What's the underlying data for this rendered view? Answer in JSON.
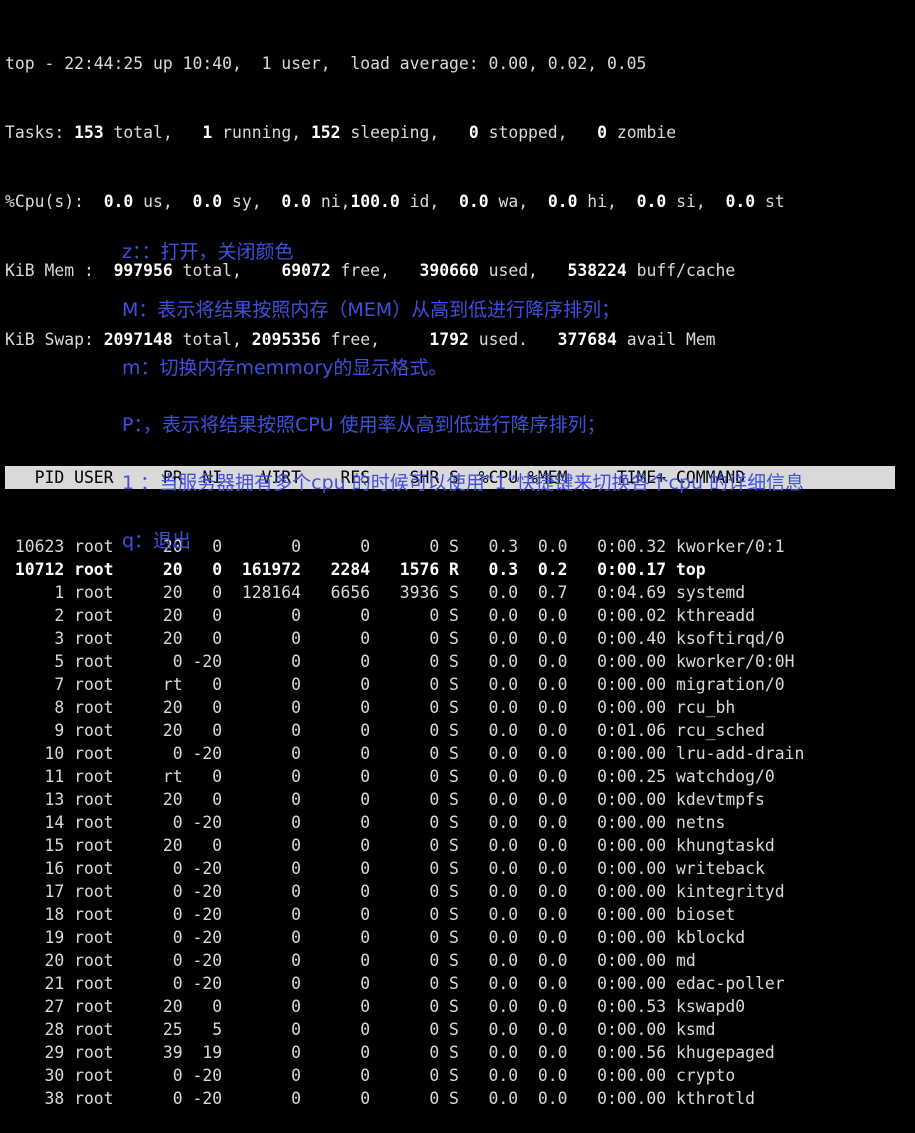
{
  "summary": {
    "uptime_line": [
      "top - 22:44:25 up 10:40,  1 user,  load average: 0.00, 0.02, 0.05"
    ],
    "tasks": [
      [
        "Tasks: ",
        false
      ],
      [
        "153",
        true
      ],
      [
        " total,   ",
        false
      ],
      [
        "1",
        true
      ],
      [
        " running, ",
        false
      ],
      [
        "152",
        true
      ],
      [
        " sleeping,   ",
        false
      ],
      [
        "0",
        true
      ],
      [
        " stopped,   ",
        false
      ],
      [
        "0",
        true
      ],
      [
        " zombie",
        false
      ]
    ],
    "cpu": [
      [
        "%Cpu(s):  ",
        false
      ],
      [
        "0.0",
        true
      ],
      [
        " us,  ",
        false
      ],
      [
        "0.0",
        true
      ],
      [
        " sy,  ",
        false
      ],
      [
        "0.0",
        true
      ],
      [
        " ni,",
        false
      ],
      [
        "100.0",
        true
      ],
      [
        " id,  ",
        false
      ],
      [
        "0.0",
        true
      ],
      [
        " wa,  ",
        false
      ],
      [
        "0.0",
        true
      ],
      [
        " hi,  ",
        false
      ],
      [
        "0.0",
        true
      ],
      [
        " si,  ",
        false
      ],
      [
        "0.0",
        true
      ],
      [
        " st",
        false
      ]
    ],
    "mem": [
      [
        "KiB Mem :  ",
        false
      ],
      [
        "997956",
        true
      ],
      [
        " total,    ",
        false
      ],
      [
        "69072",
        true
      ],
      [
        " free,   ",
        false
      ],
      [
        "390660",
        true
      ],
      [
        " used,   ",
        false
      ],
      [
        "538224",
        true
      ],
      [
        " buff/cache",
        false
      ]
    ],
    "swap": [
      [
        "KiB Swap: ",
        false
      ],
      [
        "2097148",
        true
      ],
      [
        " total, ",
        false
      ],
      [
        "2095356",
        true
      ],
      [
        " free,     ",
        false
      ],
      [
        "1792",
        true
      ],
      [
        " used.   ",
        false
      ],
      [
        "377684",
        true
      ],
      [
        " avail Mem",
        false
      ]
    ]
  },
  "columns": [
    "PID",
    "USER",
    "PR",
    "NI",
    "VIRT",
    "RES",
    "SHR",
    "S",
    "%CPU",
    "%MEM",
    "TIME+",
    "COMMAND"
  ],
  "processes": [
    {
      "pid": "10623",
      "user": "root",
      "pr": "20",
      "ni": "0",
      "virt": "0",
      "res": "0",
      "shr": "0",
      "s": "S",
      "cpu": "0.3",
      "mem": "0.0",
      "time": "0:00.32",
      "cmd": "kworker/0:1",
      "bold": false
    },
    {
      "pid": "10712",
      "user": "root",
      "pr": "20",
      "ni": "0",
      "virt": "161972",
      "res": "2284",
      "shr": "1576",
      "s": "R",
      "cpu": "0.3",
      "mem": "0.2",
      "time": "0:00.17",
      "cmd": "top",
      "bold": true
    },
    {
      "pid": "1",
      "user": "root",
      "pr": "20",
      "ni": "0",
      "virt": "128164",
      "res": "6656",
      "shr": "3936",
      "s": "S",
      "cpu": "0.0",
      "mem": "0.7",
      "time": "0:04.69",
      "cmd": "systemd",
      "bold": false
    },
    {
      "pid": "2",
      "user": "root",
      "pr": "20",
      "ni": "0",
      "virt": "0",
      "res": "0",
      "shr": "0",
      "s": "S",
      "cpu": "0.0",
      "mem": "0.0",
      "time": "0:00.02",
      "cmd": "kthreadd",
      "bold": false
    },
    {
      "pid": "3",
      "user": "root",
      "pr": "20",
      "ni": "0",
      "virt": "0",
      "res": "0",
      "shr": "0",
      "s": "S",
      "cpu": "0.0",
      "mem": "0.0",
      "time": "0:00.40",
      "cmd": "ksoftirqd/0",
      "bold": false
    },
    {
      "pid": "5",
      "user": "root",
      "pr": "0",
      "ni": "-20",
      "virt": "0",
      "res": "0",
      "shr": "0",
      "s": "S",
      "cpu": "0.0",
      "mem": "0.0",
      "time": "0:00.00",
      "cmd": "kworker/0:0H",
      "bold": false
    },
    {
      "pid": "7",
      "user": "root",
      "pr": "rt",
      "ni": "0",
      "virt": "0",
      "res": "0",
      "shr": "0",
      "s": "S",
      "cpu": "0.0",
      "mem": "0.0",
      "time": "0:00.00",
      "cmd": "migration/0",
      "bold": false
    },
    {
      "pid": "8",
      "user": "root",
      "pr": "20",
      "ni": "0",
      "virt": "0",
      "res": "0",
      "shr": "0",
      "s": "S",
      "cpu": "0.0",
      "mem": "0.0",
      "time": "0:00.00",
      "cmd": "rcu_bh",
      "bold": false
    },
    {
      "pid": "9",
      "user": "root",
      "pr": "20",
      "ni": "0",
      "virt": "0",
      "res": "0",
      "shr": "0",
      "s": "S",
      "cpu": "0.0",
      "mem": "0.0",
      "time": "0:01.06",
      "cmd": "rcu_sched",
      "bold": false
    },
    {
      "pid": "10",
      "user": "root",
      "pr": "0",
      "ni": "-20",
      "virt": "0",
      "res": "0",
      "shr": "0",
      "s": "S",
      "cpu": "0.0",
      "mem": "0.0",
      "time": "0:00.00",
      "cmd": "lru-add-drain",
      "bold": false
    },
    {
      "pid": "11",
      "user": "root",
      "pr": "rt",
      "ni": "0",
      "virt": "0",
      "res": "0",
      "shr": "0",
      "s": "S",
      "cpu": "0.0",
      "mem": "0.0",
      "time": "0:00.25",
      "cmd": "watchdog/0",
      "bold": false
    },
    {
      "pid": "13",
      "user": "root",
      "pr": "20",
      "ni": "0",
      "virt": "0",
      "res": "0",
      "shr": "0",
      "s": "S",
      "cpu": "0.0",
      "mem": "0.0",
      "time": "0:00.00",
      "cmd": "kdevtmpfs",
      "bold": false
    },
    {
      "pid": "14",
      "user": "root",
      "pr": "0",
      "ni": "-20",
      "virt": "0",
      "res": "0",
      "shr": "0",
      "s": "S",
      "cpu": "0.0",
      "mem": "0.0",
      "time": "0:00.00",
      "cmd": "netns",
      "bold": false
    },
    {
      "pid": "15",
      "user": "root",
      "pr": "20",
      "ni": "0",
      "virt": "0",
      "res": "0",
      "shr": "0",
      "s": "S",
      "cpu": "0.0",
      "mem": "0.0",
      "time": "0:00.00",
      "cmd": "khungtaskd",
      "bold": false
    },
    {
      "pid": "16",
      "user": "root",
      "pr": "0",
      "ni": "-20",
      "virt": "0",
      "res": "0",
      "shr": "0",
      "s": "S",
      "cpu": "0.0",
      "mem": "0.0",
      "time": "0:00.00",
      "cmd": "writeback",
      "bold": false
    },
    {
      "pid": "17",
      "user": "root",
      "pr": "0",
      "ni": "-20",
      "virt": "0",
      "res": "0",
      "shr": "0",
      "s": "S",
      "cpu": "0.0",
      "mem": "0.0",
      "time": "0:00.00",
      "cmd": "kintegrityd",
      "bold": false
    },
    {
      "pid": "18",
      "user": "root",
      "pr": "0",
      "ni": "-20",
      "virt": "0",
      "res": "0",
      "shr": "0",
      "s": "S",
      "cpu": "0.0",
      "mem": "0.0",
      "time": "0:00.00",
      "cmd": "bioset",
      "bold": false
    },
    {
      "pid": "19",
      "user": "root",
      "pr": "0",
      "ni": "-20",
      "virt": "0",
      "res": "0",
      "shr": "0",
      "s": "S",
      "cpu": "0.0",
      "mem": "0.0",
      "time": "0:00.00",
      "cmd": "kblockd",
      "bold": false
    },
    {
      "pid": "20",
      "user": "root",
      "pr": "0",
      "ni": "-20",
      "virt": "0",
      "res": "0",
      "shr": "0",
      "s": "S",
      "cpu": "0.0",
      "mem": "0.0",
      "time": "0:00.00",
      "cmd": "md",
      "bold": false
    },
    {
      "pid": "21",
      "user": "root",
      "pr": "0",
      "ni": "-20",
      "virt": "0",
      "res": "0",
      "shr": "0",
      "s": "S",
      "cpu": "0.0",
      "mem": "0.0",
      "time": "0:00.00",
      "cmd": "edac-poller",
      "bold": false
    },
    {
      "pid": "27",
      "user": "root",
      "pr": "20",
      "ni": "0",
      "virt": "0",
      "res": "0",
      "shr": "0",
      "s": "S",
      "cpu": "0.0",
      "mem": "0.0",
      "time": "0:00.53",
      "cmd": "kswapd0",
      "bold": false
    },
    {
      "pid": "28",
      "user": "root",
      "pr": "25",
      "ni": "5",
      "virt": "0",
      "res": "0",
      "shr": "0",
      "s": "S",
      "cpu": "0.0",
      "mem": "0.0",
      "time": "0:00.00",
      "cmd": "ksmd",
      "bold": false
    },
    {
      "pid": "29",
      "user": "root",
      "pr": "39",
      "ni": "19",
      "virt": "0",
      "res": "0",
      "shr": "0",
      "s": "S",
      "cpu": "0.0",
      "mem": "0.0",
      "time": "0:00.56",
      "cmd": "khugepaged",
      "bold": false
    },
    {
      "pid": "30",
      "user": "root",
      "pr": "0",
      "ni": "-20",
      "virt": "0",
      "res": "0",
      "shr": "0",
      "s": "S",
      "cpu": "0.0",
      "mem": "0.0",
      "time": "0:00.00",
      "cmd": "crypto",
      "bold": false
    },
    {
      "pid": "38",
      "user": "root",
      "pr": "0",
      "ni": "-20",
      "virt": "0",
      "res": "0",
      "shr": "0",
      "s": "S",
      "cpu": "0.0",
      "mem": "0.0",
      "time": "0:00.00",
      "cmd": "kthrotld",
      "bold": false
    }
  ],
  "annotations": [
    "z：：打开，关闭颜色",
    "M：表示将结果按照内存（MEM）从高到低进行降序排列；",
    "m：切换内存memmory的显示格式。",
    "P：，表示将结果按照CPU 使用率从高到低进行降序排列；",
    "1 ：当服务器拥有多个cpu 的时候可以使用“1”快捷键来切换各个cpu 的详细信息",
    "q：退出"
  ],
  "colors": {
    "background": "#000000",
    "text": "#d9d9d9",
    "bold_text": "#ffffff",
    "header_bg": "#d9d9d9",
    "annotation": "#4050dd"
  }
}
